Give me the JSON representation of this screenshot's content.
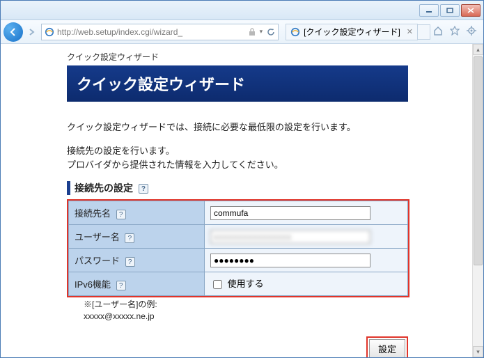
{
  "window": {
    "url": "http://web.setup/index.cgi/wizard_",
    "url_suffix_icons": [
      "lock",
      "refresh"
    ]
  },
  "tab": {
    "title": "[クイック設定ウィザード]"
  },
  "page": {
    "breadcrumb": "クイック設定ウィザード",
    "banner": "クイック設定ウィザード",
    "intro": "クイック設定ウィザードでは、接続に必要な最低限の設定を行います。",
    "sub_line1": "接続先の設定を行います。",
    "sub_line2": "プロバイダから提供された情報を入力してください。",
    "section_title": "接続先の設定",
    "fields": {
      "conn_name": {
        "label": "接続先名",
        "value": "commufa"
      },
      "username": {
        "label": "ユーザー名",
        "value": "xxxxxxxxxxxxxxxx"
      },
      "password": {
        "label": "パスワード",
        "value": "●●●●●●●●"
      },
      "ipv6": {
        "label": "IPv6機能",
        "checkbox_label": "使用する",
        "checked": false
      }
    },
    "note_label": "※[ユーザー名]の例:",
    "note_example": "xxxxx@xxxxx.ne.jp",
    "submit_label": "設定"
  }
}
